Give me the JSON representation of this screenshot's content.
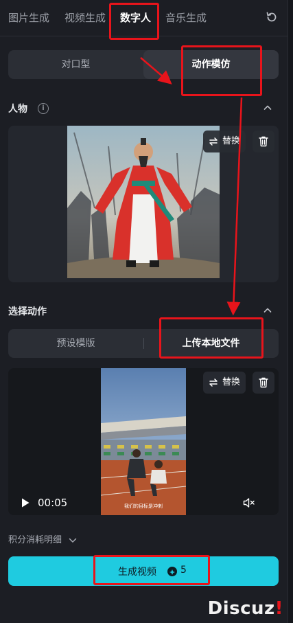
{
  "nav": {
    "tabs": [
      {
        "label": "图片生成"
      },
      {
        "label": "视频生成"
      },
      {
        "label": "数字人",
        "active": true
      },
      {
        "label": "音乐生成"
      }
    ]
  },
  "mode_toggle": {
    "options": [
      "对口型",
      "动作模仿"
    ],
    "selected": "动作模仿"
  },
  "person_section": {
    "title": "人物",
    "replace_label": "替换"
  },
  "action_section": {
    "title": "选择动作",
    "options": [
      "预设模版",
      "上传本地文件"
    ],
    "selected": "上传本地文件",
    "replace_label": "替换",
    "video_time": "00:05",
    "video_caption": "我们的目标是冲刺"
  },
  "points_label": "积分消耗明细",
  "generate": {
    "label": "生成视频",
    "cost": "5"
  },
  "watermark": {
    "text": "Discuz",
    "mark": "!"
  },
  "colors": {
    "accent": "#1fcbe0",
    "annotation": "#e8141b",
    "panel": "#1c1e24"
  },
  "icons": [
    "refresh-icon",
    "info-icon",
    "chevron-up-icon",
    "swap-icon",
    "trash-icon",
    "play-icon",
    "mute-icon",
    "chevron-down-icon",
    "coin-icon"
  ]
}
